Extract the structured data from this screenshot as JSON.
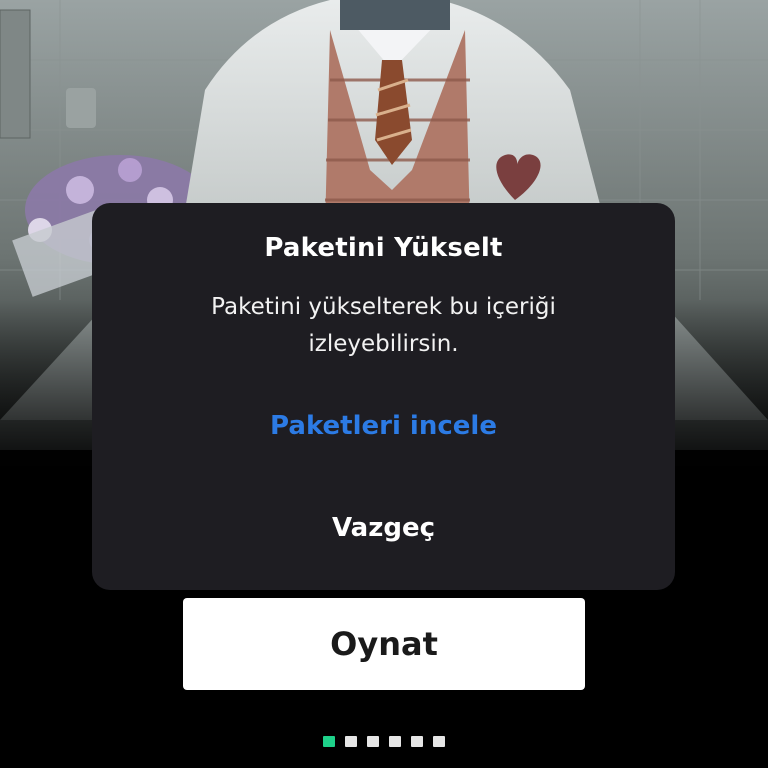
{
  "dialog": {
    "title": "Paketini Yükselt",
    "message": "Paketini yükselterek bu içeriği izleyebilirsin.",
    "link_label": "Paketleri incele",
    "cancel_label": "Vazgeç"
  },
  "hero": {
    "play_label": "Oynat"
  },
  "pager": {
    "count": 6,
    "active_index": 0,
    "active_color": "#1ed18a",
    "inactive_color": "#e6e6e6"
  },
  "colors": {
    "dialog_bg": "#1e1d22",
    "link": "#2c7be5",
    "play_button_bg": "#ffffff"
  }
}
